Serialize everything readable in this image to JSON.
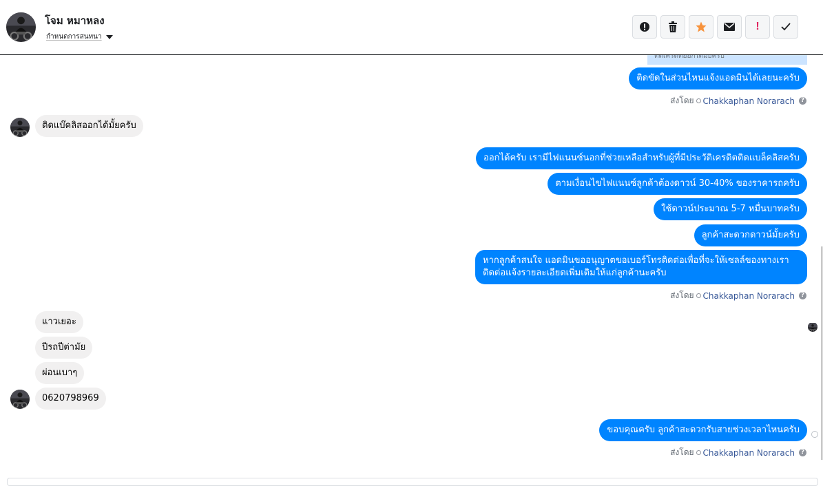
{
  "header": {
    "contact_name": "โจม หมาหลง",
    "conversation_action": "กำหนดการสนทนา",
    "toolbar": [
      {
        "name": "spam-alert-button",
        "icon": "alert-circle-icon"
      },
      {
        "name": "delete-button",
        "icon": "trash-icon"
      },
      {
        "name": "star-button",
        "icon": "star-icon",
        "color": "#f7923b"
      },
      {
        "name": "mark-unread-button",
        "icon": "envelope-icon"
      },
      {
        "name": "follow-up-button",
        "icon": "exclamation-icon",
        "color": "#e0245e"
      },
      {
        "name": "mark-done-button",
        "icon": "checkmark-icon"
      }
    ]
  },
  "chat": {
    "quoted_snippet": "ติดเครดิตออกได้มั้ยครับ",
    "outgoing_1": "ติดขัดในส่วนไหนแจ้งแอดมินได้เลยนะครับ",
    "sent_by_label": "ส่งโดย",
    "agent_name": "Chakkaphan Norarach",
    "incoming_1": "ติดแบ๊คลิสออกได้มั้ยครับ",
    "outgoing_group": [
      "ออกได้ครับ เรามีไฟแนนซ์นอกที่ช่วยเหลือสำหรับผู้ที่มีประวัติเครดิตติดแบล็คลิสครับ",
      "ตามเงื่อนไขไฟแนนซ์ลูกค้าต้องดาวน์ 30-40% ของราคารถครับ",
      "ใช้ดาวน์ประมาณ 5-7 หมื่นบาทครับ",
      "ลูกค้าสะดวกดาวน์มั้ยครับ",
      "หากลูกค้าสนใจ แอดมินขออนุญาตขอเบอร์โทรติดต่อเพื่อที่จะให้เซลล์ของทางเราติดต่อแจ้งรายละเอียดเพิ่มเติมให้แก่ลูกค้านะครับ"
    ],
    "incoming_group": [
      "แาวเยอะ",
      "ปีรถปีต่ามัย",
      "ผ่อนเบาๆ",
      "0620798969"
    ],
    "outgoing_last": "ขอบคุณครับ ลูกค้าสะดวกรับสายช่วงเวลาไหนครับ",
    "colors": {
      "outgoing_bubble": "#0084ff",
      "incoming_bubble": "#f1f0f0",
      "agent_link": "#385898"
    }
  }
}
